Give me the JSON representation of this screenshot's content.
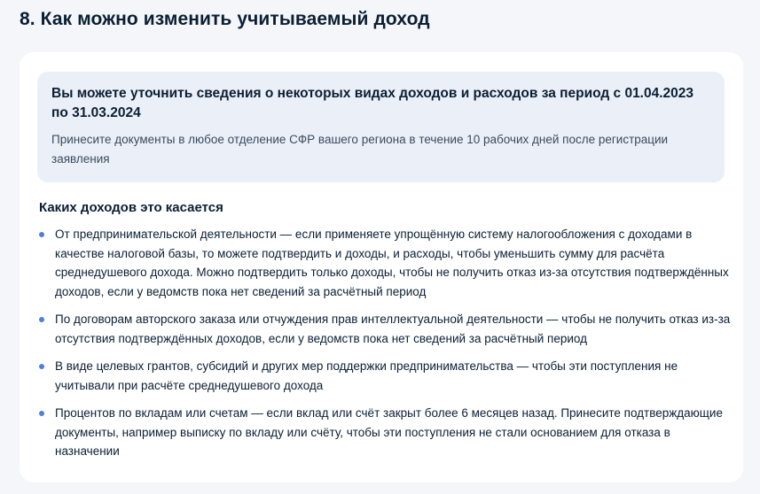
{
  "page": {
    "title": "8. Как можно изменить учитываемый доход"
  },
  "info": {
    "title": "Вы можете уточнить сведения о некоторых видах доходов и расходов за период с 01.04.2023 по 31.03.2024",
    "text": "Принесите документы в любое отделение СФР вашего региона в течение 10 рабочих дней после регистрации заявления"
  },
  "section": {
    "heading": "Каких доходов это касается",
    "items": [
      {
        "text": "От предпринимательской деятельности — если применяете упрощённую систему налогообложения с доходами в качестве налоговой базы, то можете подтвердить и доходы, и расходы, чтобы уменьшить сумму для расчёта среднедушевого дохода. Можно подтвердить только доходы, чтобы не получить отказ из-за отсутствия подтверждённых доходов, если у ведомств пока нет сведений за расчётный период"
      },
      {
        "text": "По договорам авторского заказа или отчуждения прав интеллектуальной деятельности — чтобы не получить отказ из-за отсутствия подтверждённых доходов, если у ведомств пока нет сведений за расчётный период"
      },
      {
        "text": "В виде целевых грантов, субсидий и других мер поддержки предпринимательства — чтобы эти поступления не учитывали при расчёте среднедушевого дохода"
      },
      {
        "text": "Процентов по вкладам или счетам — если вклад или счёт закрыт более 6 месяцев назад. Принесите подтверждающие документы, например выписку по вкладу или счёту, чтобы эти поступления не стали основанием для отказа в назначении"
      }
    ]
  },
  "colors": {
    "background": "#f4f6fa",
    "card": "#ffffff",
    "info_box": "#ebf0f8",
    "bullet": "#4e7ee0",
    "text_primary": "#0b1f33",
    "text_secondary": "#3a4a5c"
  }
}
